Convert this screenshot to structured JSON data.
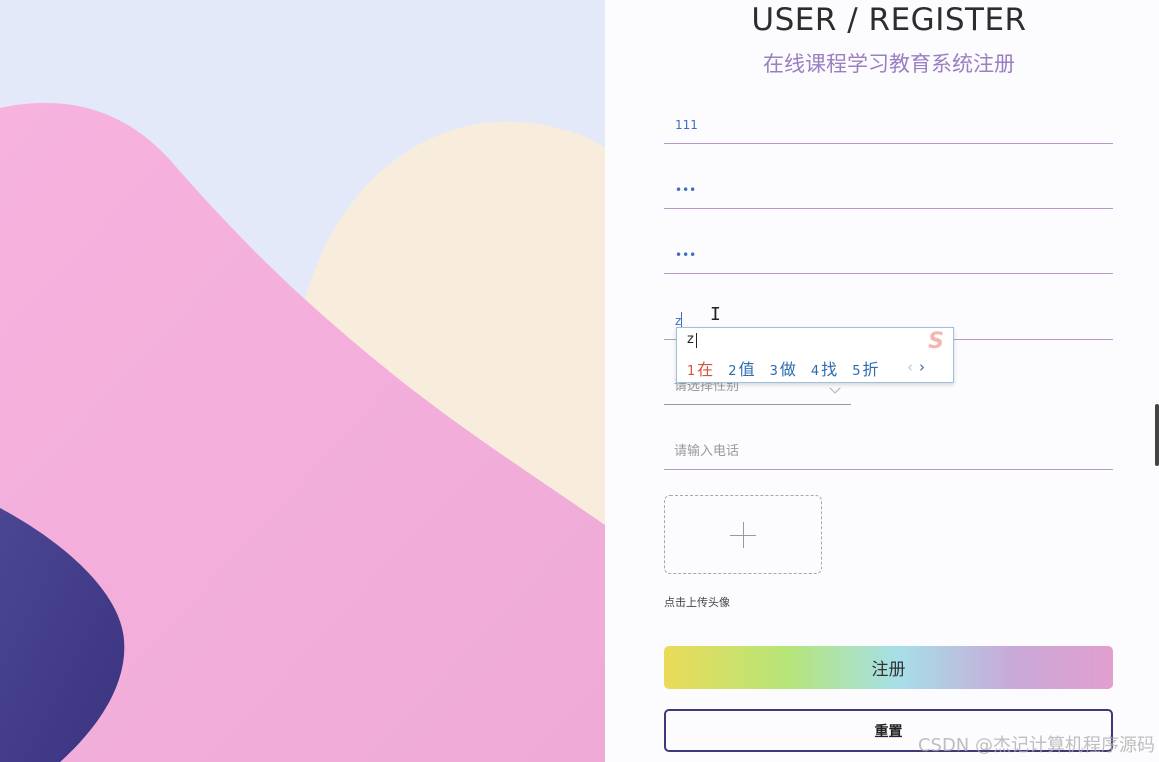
{
  "header": {
    "title": "USER / REGISTER",
    "subtitle": "在线课程学习教育系统注册"
  },
  "form": {
    "username": {
      "value": "111"
    },
    "password": {
      "value": "•••"
    },
    "confirm_password": {
      "value": "•••"
    },
    "name": {
      "value": "z"
    },
    "gender": {
      "placeholder": "请选择性别"
    },
    "phone": {
      "placeholder": "请输入电话"
    },
    "upload_label": "点击上传头像",
    "register_label": "注册",
    "reset_label": "重置"
  },
  "ime": {
    "composition": "z",
    "candidates": [
      {
        "num": "1",
        "text": "在"
      },
      {
        "num": "2",
        "text": "值"
      },
      {
        "num": "3",
        "text": "做"
      },
      {
        "num": "4",
        "text": "找"
      },
      {
        "num": "5",
        "text": "折"
      }
    ],
    "prev": "‹",
    "next": "›",
    "logo": "S"
  },
  "watermark": "CSDN @杰记计算机程序源码",
  "colors": {
    "accent": "#9b7fc2",
    "underline": "#b89ac8",
    "reset_border": "#3d3a7c"
  }
}
